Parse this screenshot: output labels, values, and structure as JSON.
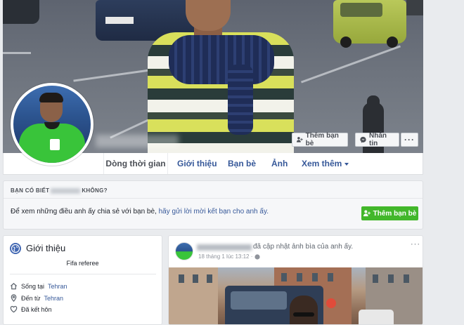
{
  "cover": {
    "add_friend_label": "Thêm bạn bè",
    "message_label": "Nhắn tin",
    "more_label": "···"
  },
  "tabs": {
    "timeline": "Dòng thời gian",
    "about": "Giới thiệu",
    "friends": "Bạn bè",
    "photos": "Ảnh",
    "more": "Xem thêm"
  },
  "know_card": {
    "title_prefix": "BẠN CÓ BIẾT",
    "title_suffix": "KHÔNG?",
    "message_text": "Để xem những điều anh ấy chia sẻ với bạn bè,",
    "message_link": "hãy gửi lời mời kết bạn cho anh ấy.",
    "add_friend_label": "Thêm bạn bè"
  },
  "intro": {
    "heading": "Giới thiệu",
    "bio": "Fifa referee",
    "lives_in_prefix": "Sống tại",
    "lives_in_city": "Tehran",
    "from_prefix": "Đến từ",
    "from_city": "Tehran",
    "relationship": "Đã kết hôn"
  },
  "post": {
    "action": "đã cập nhật ảnh bìa của anh ấy.",
    "timestamp": "18 tháng 1 lúc 13:12 ·",
    "more_label": "···"
  },
  "colors": {
    "link": "#365899",
    "green_button": "#42b72a",
    "page_bg": "#e9ebee"
  }
}
